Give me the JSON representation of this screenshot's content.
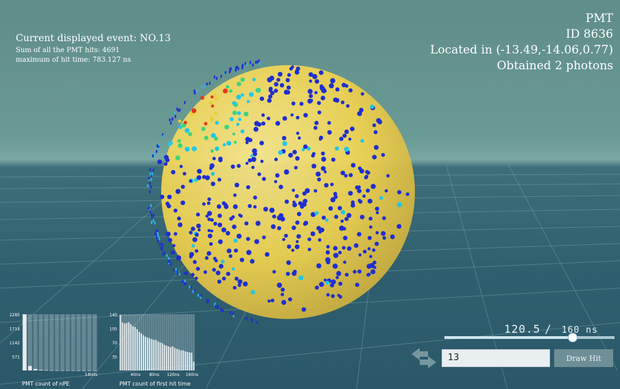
{
  "event_info": {
    "current_event": "Current displayed event: NO.13",
    "sum_hits": "Sum of all the PMT hits: 4691",
    "max_hit_time": "maximum of hit time: 783.127 ns"
  },
  "pmt_info": {
    "title": "PMT",
    "id": "ID 8636",
    "location": "Located in (-13.49,-14.06,0.77)",
    "photons": "Obtained 2 photons"
  },
  "hist_npe": {
    "caption": "PMT count of nPE",
    "y_ticks": [
      "2285",
      "1714",
      "1142",
      "571"
    ],
    "x_label_end": "14hits",
    "values": [
      2285,
      180,
      60,
      25,
      12,
      6,
      4,
      3,
      2,
      2,
      1,
      1,
      1,
      1
    ],
    "ymax": 2285
  },
  "hist_time": {
    "caption": "PMT count of first hit time",
    "y_ticks": [
      "140",
      "105",
      "70",
      "35"
    ],
    "x_ticks": [
      "40ns",
      "80ns",
      "120ns",
      "160ns"
    ],
    "values": [
      138,
      120,
      117,
      118,
      120,
      115,
      110,
      108,
      103,
      96,
      92,
      88,
      84,
      82,
      80,
      78,
      76,
      76,
      72,
      70,
      68,
      64,
      62,
      60,
      58,
      60,
      56,
      54,
      52,
      50,
      50,
      48,
      46,
      45,
      44,
      22
    ],
    "ymax": 140
  },
  "time_control": {
    "current": "120.5",
    "separator": "/",
    "max": "160 ns",
    "slider_fraction": 0.753
  },
  "event_control": {
    "input_value": "13",
    "button_label": "Draw Hit"
  },
  "colors": {
    "sphere": "#f2d44f",
    "hit_low": "#1f2fd0",
    "hit_mid": "#1fc8e8",
    "hit_high": "#e23a1a"
  }
}
